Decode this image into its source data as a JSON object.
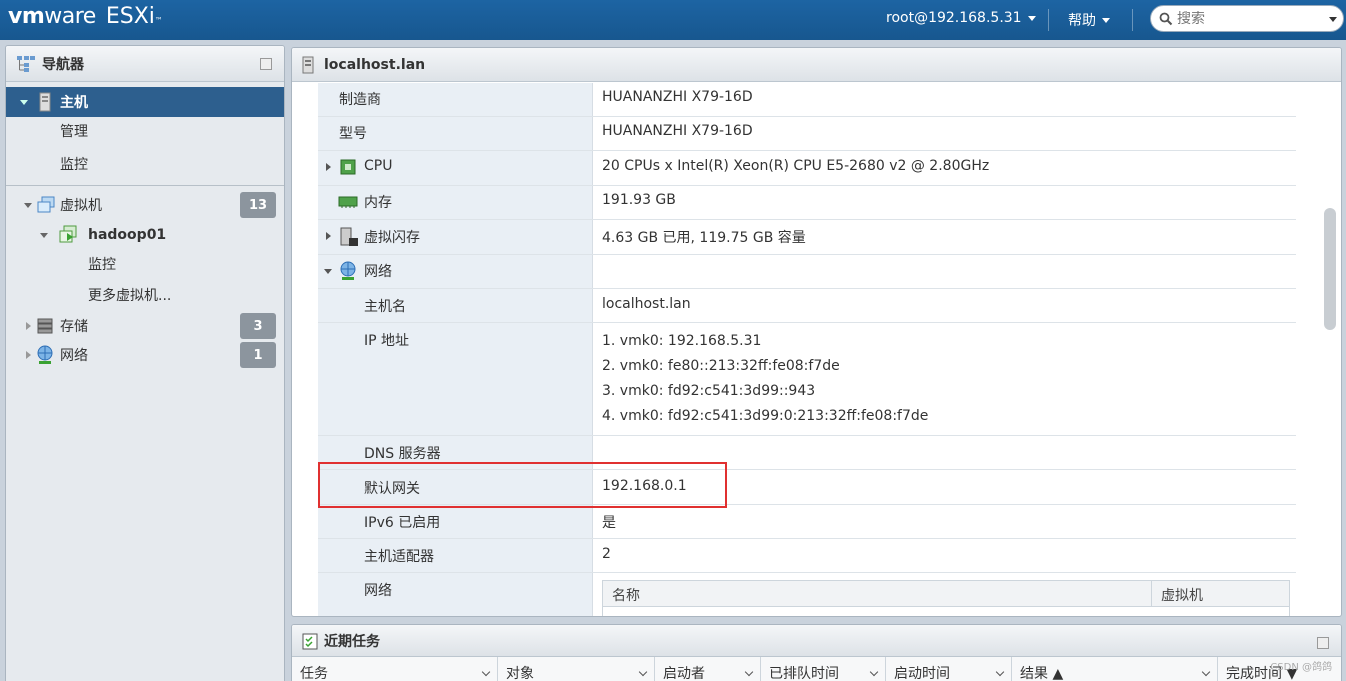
{
  "header": {
    "logo_vm": "vm",
    "logo_ware": "ware",
    "logo_esxi": "ESXi",
    "logo_tm": "™",
    "user": "root@192.168.5.31",
    "help": "帮助",
    "search_placeholder": "搜索"
  },
  "navigator": {
    "title": "导航器",
    "items": [
      {
        "label": "主机",
        "icon": "server-icon"
      },
      {
        "label": "管理"
      },
      {
        "label": "监控"
      },
      {
        "label": "虚拟机",
        "icon": "vm-group-icon",
        "badge": "13"
      },
      {
        "label": "hadoop01",
        "icon": "vm-running-icon"
      },
      {
        "label": "监控"
      },
      {
        "label": "更多虚拟机..."
      },
      {
        "label": "存储",
        "icon": "storage-icon",
        "badge": "3"
      },
      {
        "label": "网络",
        "icon": "network-icon",
        "badge": "1"
      }
    ]
  },
  "main": {
    "title": "localhost.lan",
    "rows": [
      {
        "key": "制造商",
        "value": "HUANANZHI X79-16D"
      },
      {
        "key": "型号",
        "value": "HUANANZHI X79-16D"
      },
      {
        "key": "CPU",
        "value": "20 CPUs x Intel(R) Xeon(R) CPU E5-2680 v2 @ 2.80GHz",
        "icon": "cpu-icon"
      },
      {
        "key": "内存",
        "value": "191.93 GB",
        "icon": "memory-icon"
      },
      {
        "key": "虚拟闪存",
        "value": "4.63 GB 已用, 119.75 GB 容量",
        "icon": "flash-icon"
      },
      {
        "key": "网络",
        "value": "",
        "icon": "network-icon"
      },
      {
        "key": "主机名",
        "value": "localhost.lan"
      },
      {
        "key": "IP 地址",
        "values": [
          "1. vmk0: 192.168.5.31",
          "2. vmk0: fe80::213:32ff:fe08:f7de",
          "3. vmk0: fd92:c541:3d99::943",
          "4. vmk0: fd92:c541:3d99:0:213:32ff:fe08:f7de"
        ]
      },
      {
        "key": "DNS 服务器",
        "value": ""
      },
      {
        "key": "默认网关",
        "value": "192.168.0.1"
      },
      {
        "key": "IPv6 已启用",
        "value": "是"
      },
      {
        "key": "主机适配器",
        "value": "2"
      },
      {
        "key": "网络",
        "value": ""
      }
    ],
    "nested_table": {
      "col1": "名称",
      "col2": "虚拟机"
    }
  },
  "tasks": {
    "title": "近期任务",
    "columns": [
      "任务",
      "对象",
      "启动者",
      "已排队时间",
      "启动时间",
      "结果 ▲",
      "完成时间 ▼"
    ]
  },
  "watermark": "CSDN @鸽鸽",
  "colors": {
    "topbar": "#1d64a3",
    "nav_active": "#2d5f8e",
    "highlight": "#e03030"
  }
}
